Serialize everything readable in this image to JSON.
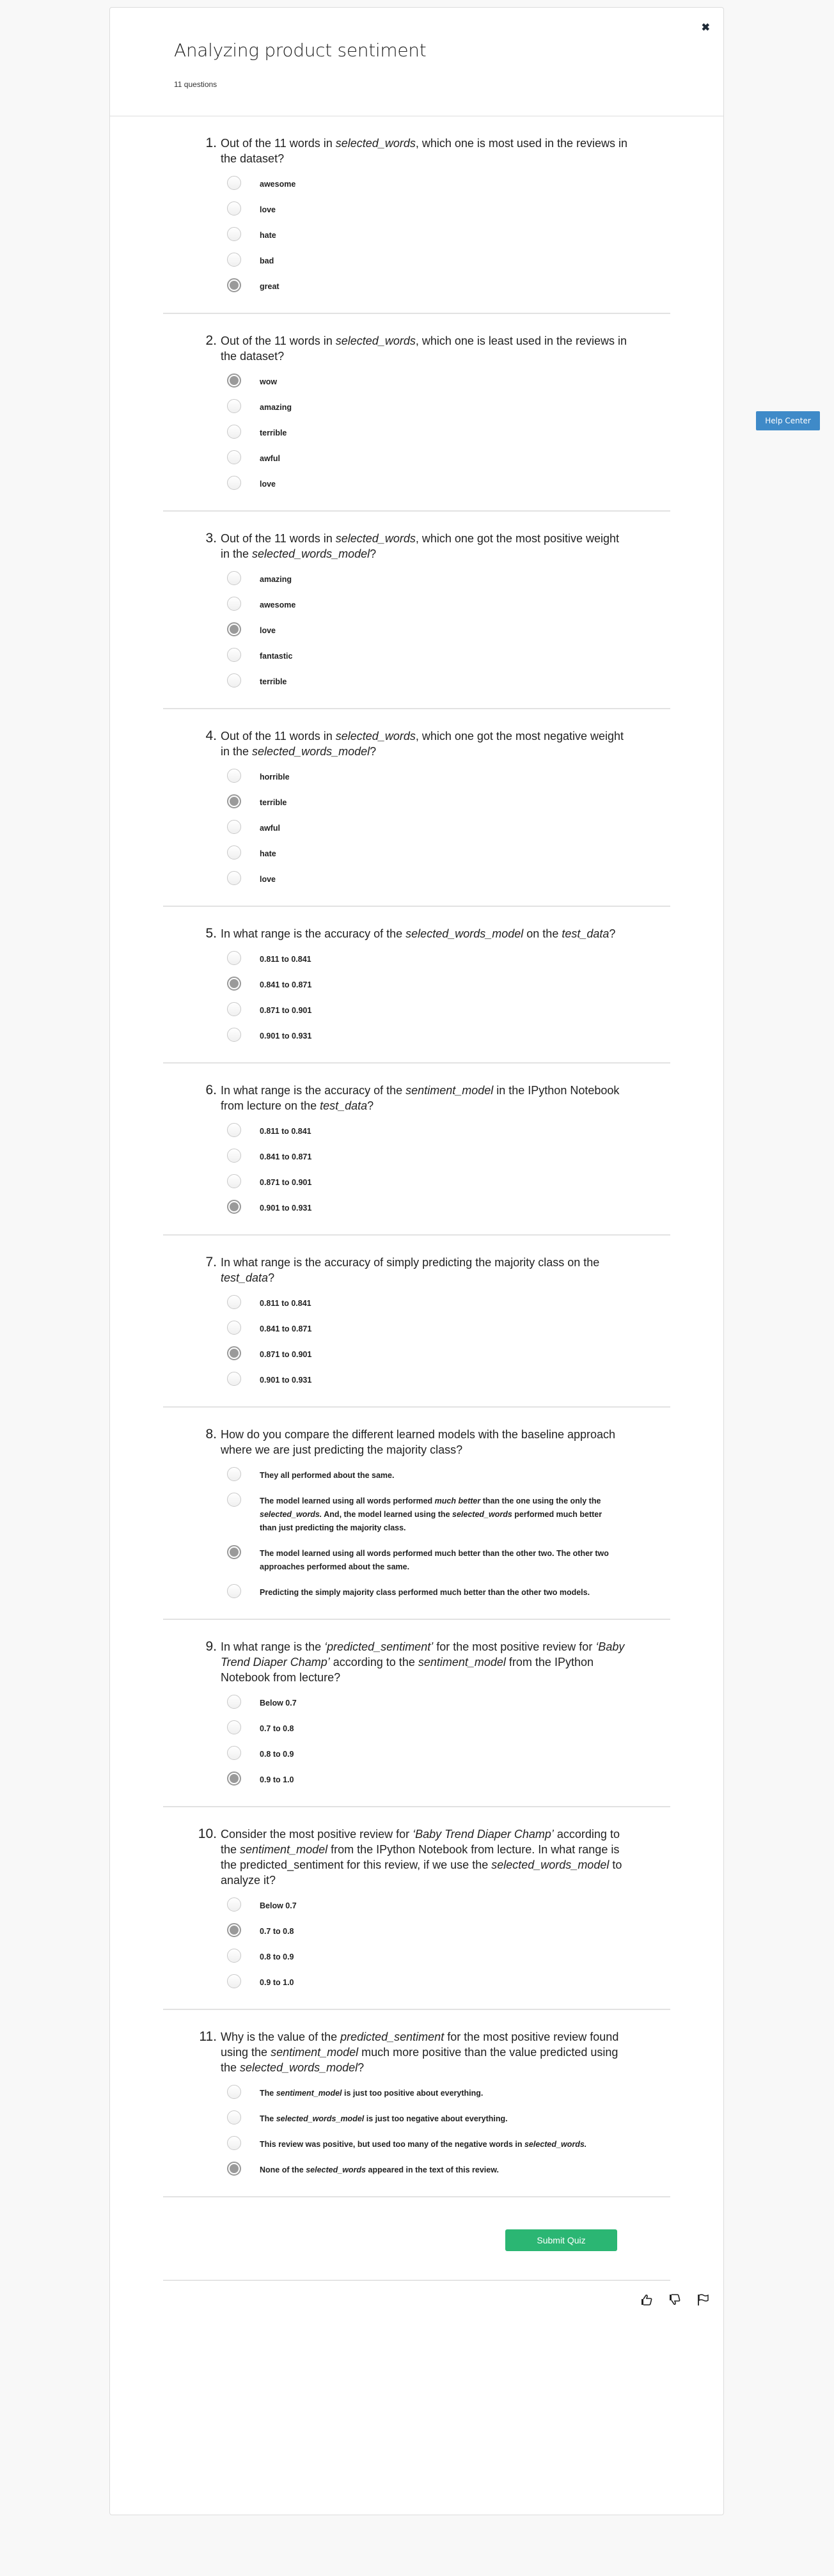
{
  "header": {
    "title": "Analyzing product sentiment",
    "subtitle": "11 questions",
    "close_icon": "close-icon"
  },
  "help_center": {
    "label": "Help Center"
  },
  "questions": [
    {
      "number": "1.",
      "text_parts": [
        {
          "t": "Out of the 11 words in "
        },
        {
          "t": "selected_words",
          "i": true
        },
        {
          "t": ", which one is most used in the reviews in the dataset?"
        }
      ],
      "options": [
        {
          "parts": [
            {
              "t": "awesome"
            }
          ],
          "selected": false
        },
        {
          "parts": [
            {
              "t": "love"
            }
          ],
          "selected": false
        },
        {
          "parts": [
            {
              "t": "hate"
            }
          ],
          "selected": false
        },
        {
          "parts": [
            {
              "t": "bad"
            }
          ],
          "selected": false
        },
        {
          "parts": [
            {
              "t": "great"
            }
          ],
          "selected": true
        }
      ]
    },
    {
      "number": "2.",
      "text_parts": [
        {
          "t": "Out of the 11 words in "
        },
        {
          "t": "selected_words",
          "i": true
        },
        {
          "t": ", which one is least used in the reviews in the dataset?"
        }
      ],
      "options": [
        {
          "parts": [
            {
              "t": "wow"
            }
          ],
          "selected": true
        },
        {
          "parts": [
            {
              "t": "amazing"
            }
          ],
          "selected": false
        },
        {
          "parts": [
            {
              "t": "terrible"
            }
          ],
          "selected": false
        },
        {
          "parts": [
            {
              "t": "awful"
            }
          ],
          "selected": false
        },
        {
          "parts": [
            {
              "t": "love"
            }
          ],
          "selected": false
        }
      ]
    },
    {
      "number": "3.",
      "text_parts": [
        {
          "t": "Out of the 11 words in "
        },
        {
          "t": "selected_words",
          "i": true
        },
        {
          "t": ", which one got the most positive weight in the "
        },
        {
          "t": "selected_words_model",
          "i": true
        },
        {
          "t": "?"
        }
      ],
      "options": [
        {
          "parts": [
            {
              "t": "amazing"
            }
          ],
          "selected": false
        },
        {
          "parts": [
            {
              "t": "awesome"
            }
          ],
          "selected": false
        },
        {
          "parts": [
            {
              "t": "love"
            }
          ],
          "selected": true
        },
        {
          "parts": [
            {
              "t": "fantastic"
            }
          ],
          "selected": false
        },
        {
          "parts": [
            {
              "t": "terrible"
            }
          ],
          "selected": false
        }
      ]
    },
    {
      "number": "4.",
      "text_parts": [
        {
          "t": "Out of the 11 words in "
        },
        {
          "t": "selected_words",
          "i": true
        },
        {
          "t": ", which one got the most negative weight in the "
        },
        {
          "t": "selected_words_model",
          "i": true
        },
        {
          "t": "?"
        }
      ],
      "options": [
        {
          "parts": [
            {
              "t": "horrible"
            }
          ],
          "selected": false
        },
        {
          "parts": [
            {
              "t": "terrible"
            }
          ],
          "selected": true
        },
        {
          "parts": [
            {
              "t": "awful"
            }
          ],
          "selected": false
        },
        {
          "parts": [
            {
              "t": "hate"
            }
          ],
          "selected": false
        },
        {
          "parts": [
            {
              "t": "love"
            }
          ],
          "selected": false
        }
      ]
    },
    {
      "number": "5.",
      "text_parts": [
        {
          "t": "In what range is the accuracy of the "
        },
        {
          "t": "selected_words_model",
          "i": true
        },
        {
          "t": " on the "
        },
        {
          "t": "test_data",
          "i": true
        },
        {
          "t": "?"
        }
      ],
      "options": [
        {
          "parts": [
            {
              "t": "0.811 to 0.841"
            }
          ],
          "selected": false
        },
        {
          "parts": [
            {
              "t": "0.841 to 0.871"
            }
          ],
          "selected": true
        },
        {
          "parts": [
            {
              "t": "0.871 to 0.901"
            }
          ],
          "selected": false
        },
        {
          "parts": [
            {
              "t": "0.901 to 0.931"
            }
          ],
          "selected": false
        }
      ]
    },
    {
      "number": "6.",
      "text_parts": [
        {
          "t": "In what range is the accuracy of the "
        },
        {
          "t": "sentiment_model",
          "i": true
        },
        {
          "t": " in the IPython Notebook from lecture on the "
        },
        {
          "t": "test_data",
          "i": true
        },
        {
          "t": "?"
        }
      ],
      "options": [
        {
          "parts": [
            {
              "t": "0.811 to 0.841"
            }
          ],
          "selected": false
        },
        {
          "parts": [
            {
              "t": "0.841 to 0.871"
            }
          ],
          "selected": false
        },
        {
          "parts": [
            {
              "t": "0.871 to 0.901"
            }
          ],
          "selected": false
        },
        {
          "parts": [
            {
              "t": "0.901 to 0.931"
            }
          ],
          "selected": true
        }
      ]
    },
    {
      "number": "7.",
      "text_parts": [
        {
          "t": "In what range is the accuracy of simply predicting the majority class on the "
        },
        {
          "t": "test_data",
          "i": true
        },
        {
          "t": "?"
        }
      ],
      "options": [
        {
          "parts": [
            {
              "t": "0.811 to 0.841"
            }
          ],
          "selected": false
        },
        {
          "parts": [
            {
              "t": "0.841 to 0.871"
            }
          ],
          "selected": false
        },
        {
          "parts": [
            {
              "t": "0.871 to 0.901"
            }
          ],
          "selected": true
        },
        {
          "parts": [
            {
              "t": "0.901 to 0.931"
            }
          ],
          "selected": false
        }
      ]
    },
    {
      "number": "8.",
      "text_parts": [
        {
          "t": "How do you compare the different learned models with the baseline approach where we are just predicting the majority class?"
        }
      ],
      "options": [
        {
          "parts": [
            {
              "t": "They all performed about the same."
            }
          ],
          "selected": false
        },
        {
          "parts": [
            {
              "t": "The model learned using all words performed "
            },
            {
              "t": "much better",
              "i": true
            },
            {
              "t": " than the one using the only the "
            },
            {
              "t": "selected_words.",
              "i": true
            },
            {
              "t": " And, the model learned using the "
            },
            {
              "t": "selected_words",
              "i": true
            },
            {
              "t": " performed much better than just predicting the majority class."
            }
          ],
          "selected": false
        },
        {
          "parts": [
            {
              "t": "The model learned using all words performed much better than the other two. The other two approaches performed about the same."
            }
          ],
          "selected": true
        },
        {
          "parts": [
            {
              "t": "Predicting the simply majority class performed much better than the other two models."
            }
          ],
          "selected": false
        }
      ]
    },
    {
      "number": "9.",
      "text_parts": [
        {
          "t": "In what range is the "
        },
        {
          "t": "‘predicted_sentiment’",
          "i": true
        },
        {
          "t": " for the most positive review for "
        },
        {
          "t": "‘Baby Trend Diaper Champ’",
          "i": true
        },
        {
          "t": " according to the "
        },
        {
          "t": "sentiment_model",
          "i": true
        },
        {
          "t": " from the IPython Notebook from lecture?"
        }
      ],
      "options": [
        {
          "parts": [
            {
              "t": "Below 0.7"
            }
          ],
          "selected": false
        },
        {
          "parts": [
            {
              "t": "0.7 to 0.8"
            }
          ],
          "selected": false
        },
        {
          "parts": [
            {
              "t": "0.8 to 0.9"
            }
          ],
          "selected": false
        },
        {
          "parts": [
            {
              "t": "0.9 to 1.0"
            }
          ],
          "selected": true
        }
      ]
    },
    {
      "number": "10.",
      "text_parts": [
        {
          "t": "Consider the most positive review for "
        },
        {
          "t": "‘Baby Trend Diaper Champ’",
          "i": true
        },
        {
          "t": " according to the "
        },
        {
          "t": "sentiment_model",
          "i": true
        },
        {
          "t": " from the IPython Notebook from lecture. In what range is the predicted_sentiment for this review, if we use the "
        },
        {
          "t": "selected_words_model",
          "i": true
        },
        {
          "t": " to analyze it?"
        }
      ],
      "options": [
        {
          "parts": [
            {
              "t": "Below 0.7"
            }
          ],
          "selected": false
        },
        {
          "parts": [
            {
              "t": "0.7 to 0.8"
            }
          ],
          "selected": true
        },
        {
          "parts": [
            {
              "t": "0.8 to 0.9"
            }
          ],
          "selected": false
        },
        {
          "parts": [
            {
              "t": "0.9 to 1.0"
            }
          ],
          "selected": false
        }
      ]
    },
    {
      "number": "11.",
      "text_parts": [
        {
          "t": "Why is the value of the "
        },
        {
          "t": "predicted_sentiment",
          "i": true
        },
        {
          "t": " for the most positive review found using the "
        },
        {
          "t": "sentiment_model",
          "i": true
        },
        {
          "t": " much more positive than the value predicted using the "
        },
        {
          "t": "selected_words_model",
          "i": true
        },
        {
          "t": "?"
        }
      ],
      "options": [
        {
          "parts": [
            {
              "t": "The "
            },
            {
              "t": "sentiment_model",
              "i": true
            },
            {
              "t": " is just too positive about everything."
            }
          ],
          "selected": false
        },
        {
          "parts": [
            {
              "t": "The "
            },
            {
              "t": "selected_words_model",
              "i": true
            },
            {
              "t": " is just too negative about everything."
            }
          ],
          "selected": false
        },
        {
          "parts": [
            {
              "t": "This review was positive, but used too many of the negative words in "
            },
            {
              "t": "selected_words.",
              "i": true
            }
          ],
          "selected": false
        },
        {
          "parts": [
            {
              "t": "None of the "
            },
            {
              "t": "selected_words",
              "i": true
            },
            {
              "t": " appeared in the text of this review."
            }
          ],
          "selected": true
        }
      ]
    }
  ],
  "submit": {
    "label": "Submit Quiz",
    "color": "#2bb673"
  },
  "footer": {
    "icons": [
      "thumbs-up-icon",
      "thumbs-down-icon",
      "flag-icon"
    ]
  }
}
